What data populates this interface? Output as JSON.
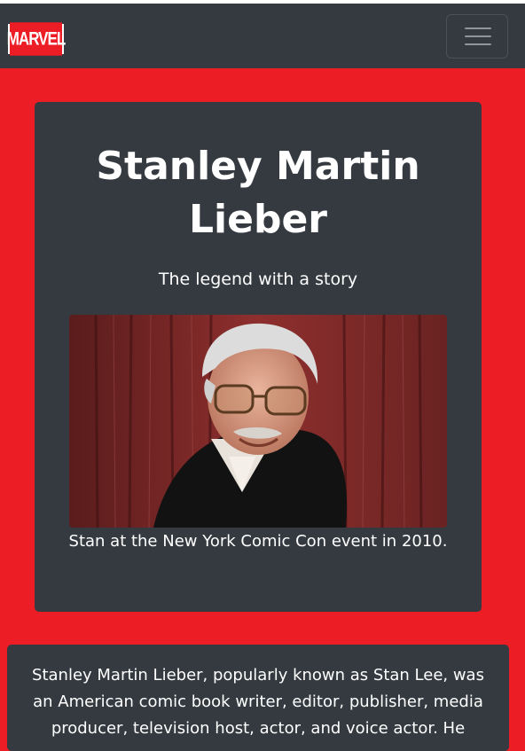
{
  "navbar": {
    "brand_logo_text": "MARVEL",
    "toggle_icon": "hamburger-menu-icon"
  },
  "hero": {
    "title": "Stanley Martin Lieber",
    "subtitle": "The legend with a story",
    "image_alt": "Stan Lee portrait",
    "caption": "Stan at the New York Comic Con event in 2010."
  },
  "bio": {
    "text": "Stanley Martin Lieber, popularly known as Stan Lee, was an American comic book writer, editor, publisher, media producer, television host, actor, and voice actor. He"
  },
  "colors": {
    "page_background": "#ec1d24",
    "navbar_background": "#343a40",
    "card_background": "#343a40",
    "text": "#ffffff"
  }
}
